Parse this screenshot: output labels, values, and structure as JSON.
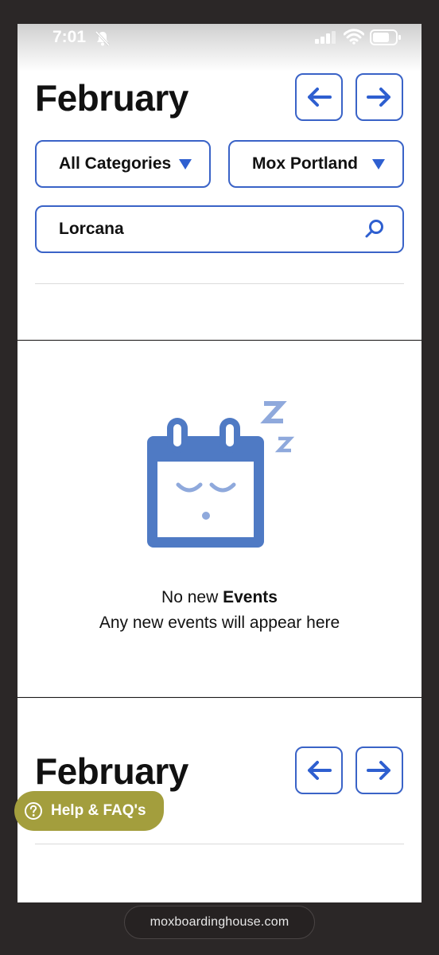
{
  "status_bar": {
    "time": "7:01"
  },
  "header": {
    "month": "February",
    "prev_label": "previous month",
    "next_label": "next month"
  },
  "filters": {
    "category": "All Categories",
    "location": "Mox Portland"
  },
  "search": {
    "value": "Lorcana"
  },
  "empty_state": {
    "title_prefix": "No new ",
    "title_bold": "Events",
    "subtitle": "Any new events will appear here"
  },
  "footer": {
    "month": "February"
  },
  "help": {
    "label": "Help & FAQ's"
  },
  "browser": {
    "url": "moxboardinghouse.com"
  },
  "colors": {
    "accent": "#3a63c7",
    "illustration": "#4f7ac4",
    "help_button": "#a39e3d"
  }
}
